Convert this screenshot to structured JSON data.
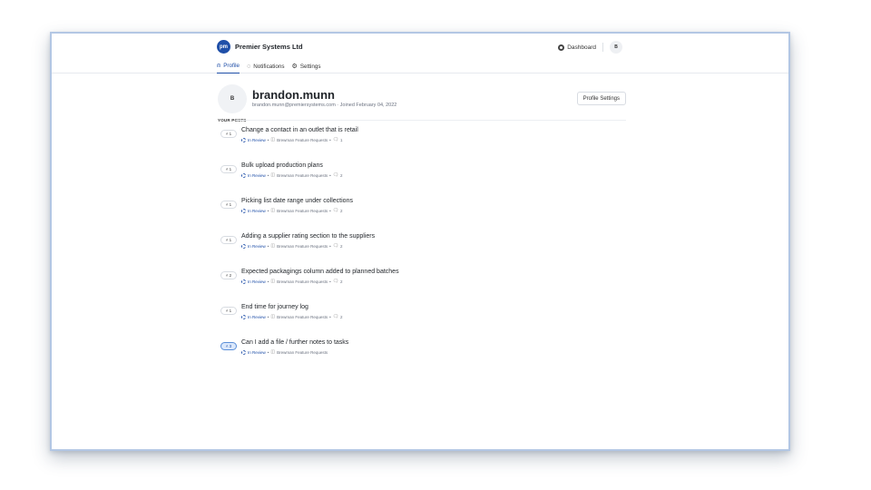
{
  "header": {
    "logo_text": "pm",
    "company": "Premier Systems Ltd",
    "dashboard_label": "Dashboard",
    "user_initial": "B"
  },
  "tabs": [
    {
      "label": "Profile",
      "icon": "user-icon",
      "active": true
    },
    {
      "label": "Notifications",
      "icon": "bell-icon",
      "active": false
    },
    {
      "label": "Settings",
      "icon": "gear-icon",
      "active": false
    }
  ],
  "profile": {
    "avatar_initial": "B",
    "username": "brandon.munn",
    "info": "brandon.munn@premiersystems.com · Joined February 04, 2022",
    "settings_button": "Profile Settings"
  },
  "posts_label": "YOUR POSTS",
  "posts": [
    {
      "votes": "1",
      "title": "Change a contact in an outlet that is retail",
      "status": "In Review",
      "board": "Brewman Feature Requests",
      "comments": "1",
      "upvoted": false
    },
    {
      "votes": "1",
      "title": "Bulk upload production plans",
      "status": "In Review",
      "board": "Brewman Feature Requests",
      "comments": "2",
      "upvoted": false
    },
    {
      "votes": "1",
      "title": "Picking list date range under collections",
      "status": "In Review",
      "board": "Brewman Feature Requests",
      "comments": "2",
      "upvoted": false
    },
    {
      "votes": "1",
      "title": "Adding a supplier rating section to the suppliers",
      "status": "In Review",
      "board": "Brewman Feature Requests",
      "comments": "2",
      "upvoted": false
    },
    {
      "votes": "2",
      "title": "Expected packagings column added to planned batches",
      "status": "In Review",
      "board": "Brewman Feature Requests",
      "comments": "2",
      "upvoted": false
    },
    {
      "votes": "1",
      "title": "End time for journey log",
      "status": "In Review",
      "board": "Brewman Feature Requests",
      "comments": "2",
      "upvoted": false
    },
    {
      "votes": "3",
      "title": "Can I add a file / further notes to tasks",
      "status": "In Review",
      "board": "Brewman Feature Requests",
      "comments": "",
      "upvoted": true
    }
  ],
  "colors": {
    "accent": "#1f4fa8",
    "window_border": "#b3c7e4",
    "muted_text": "#6b7280"
  }
}
